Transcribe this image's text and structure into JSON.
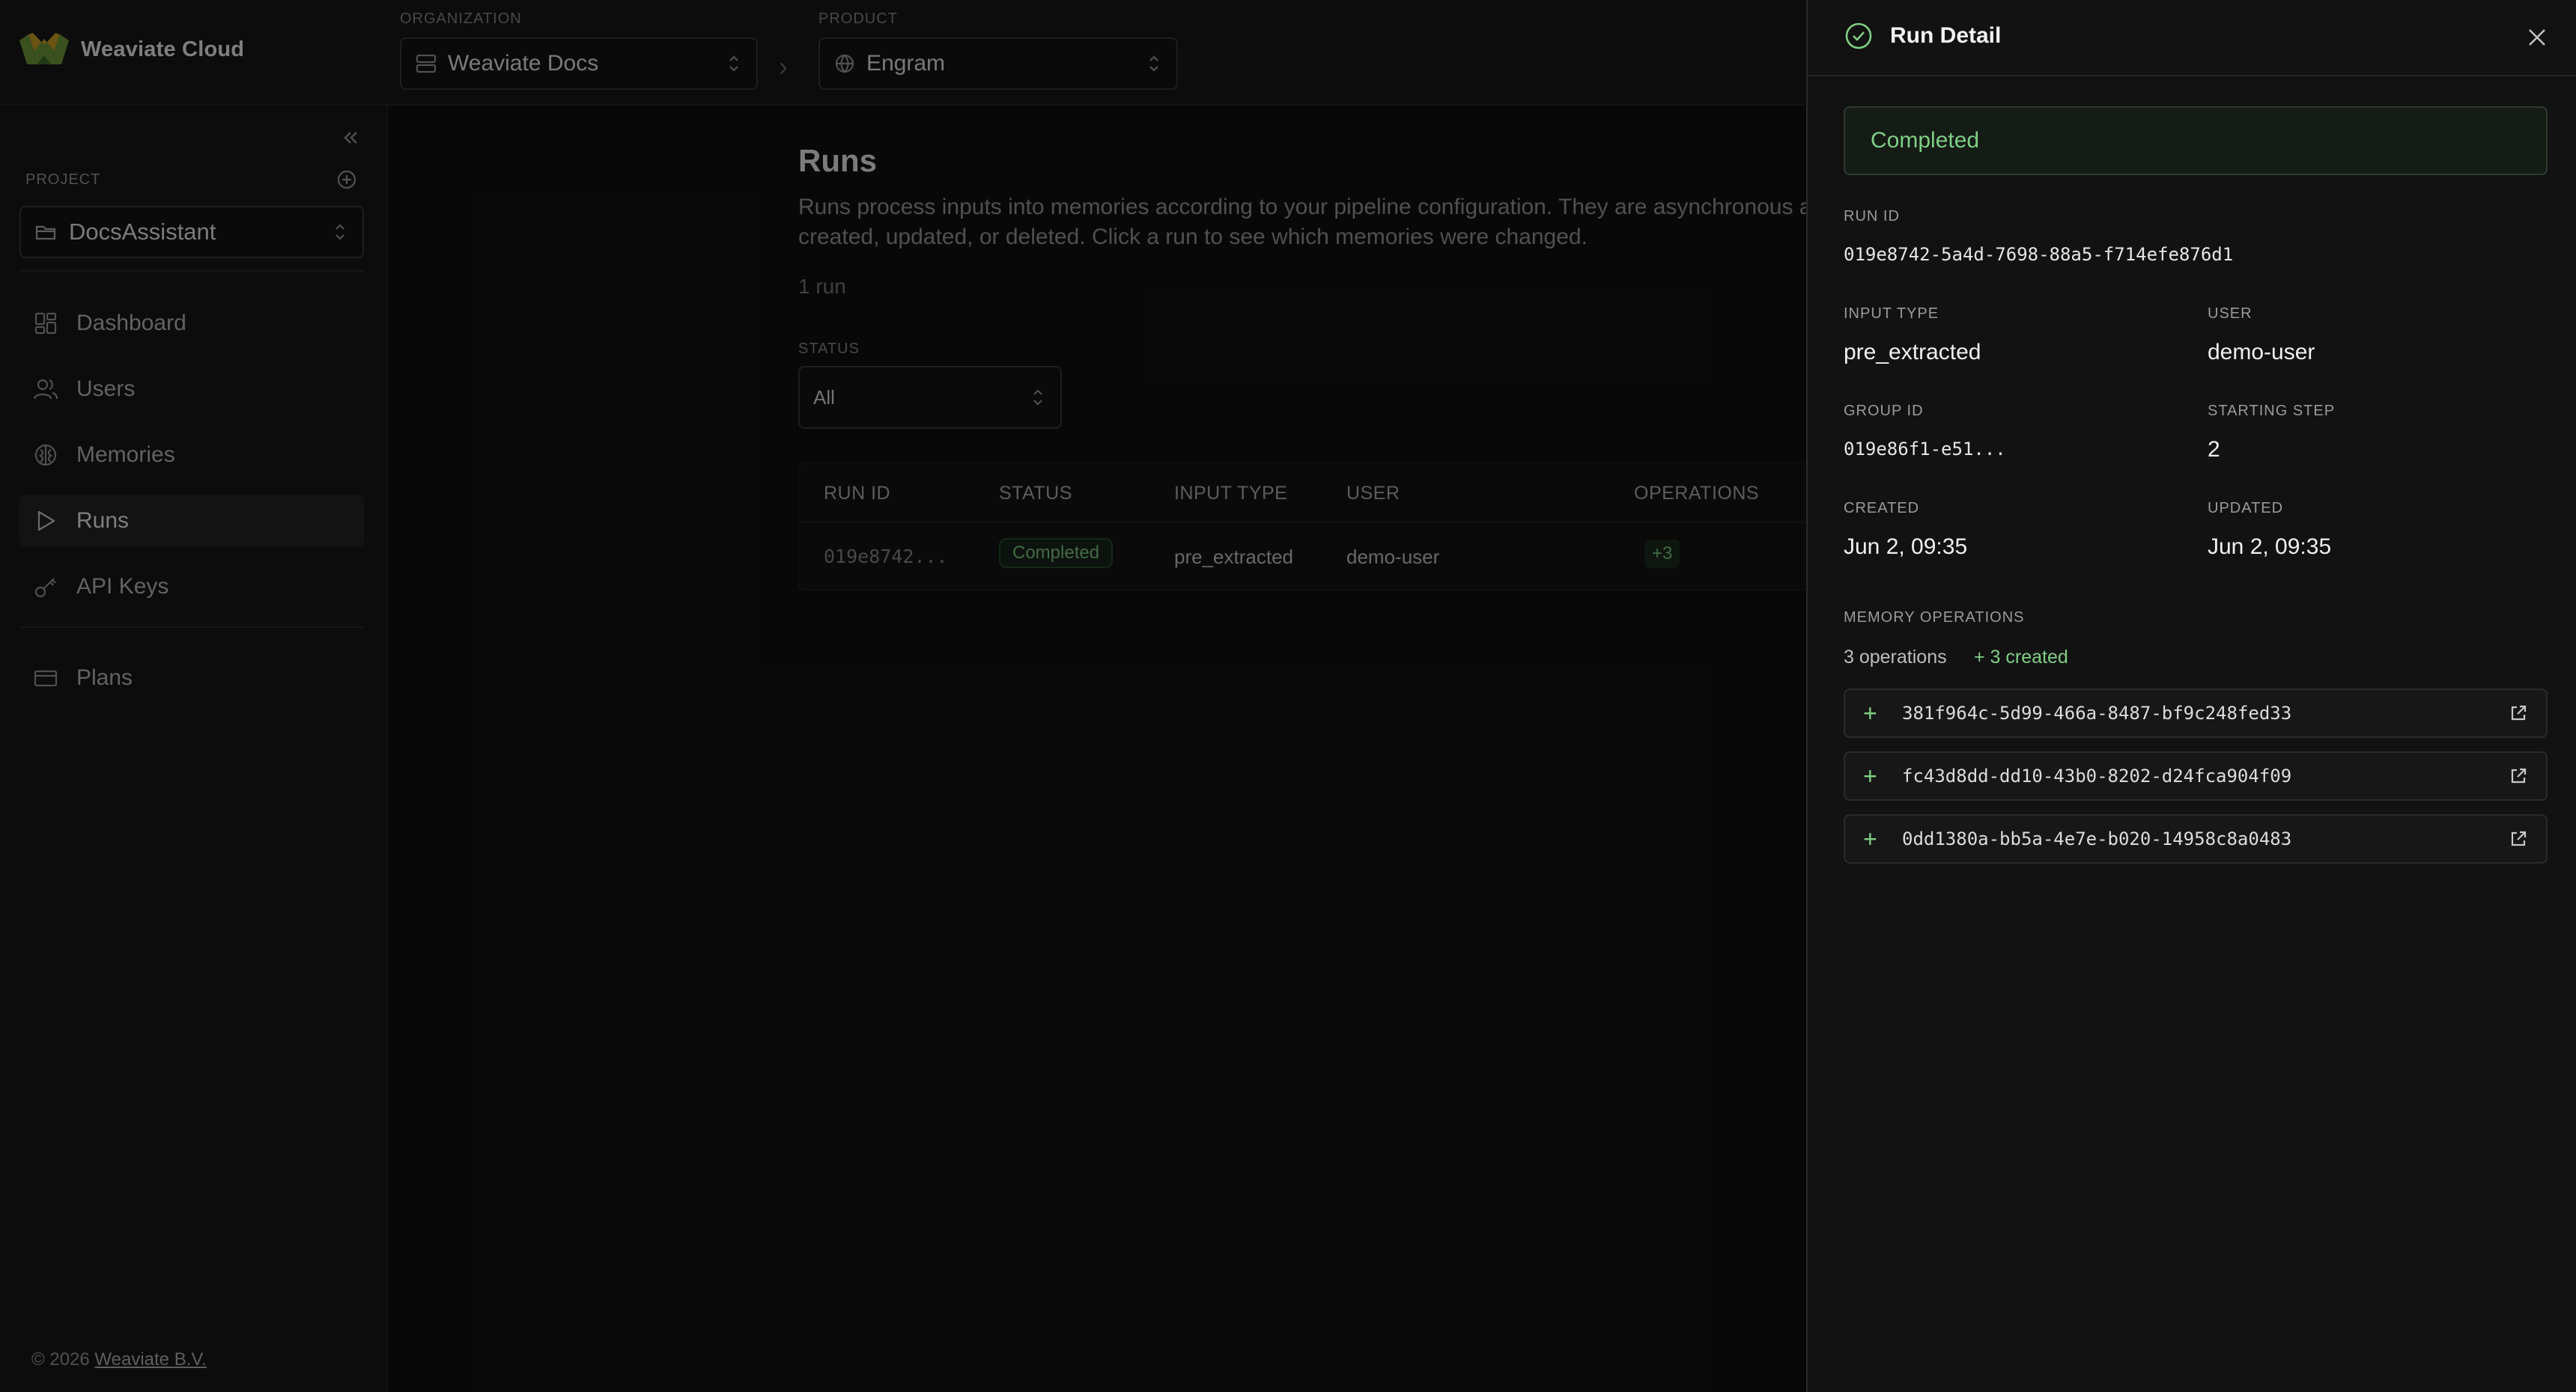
{
  "header": {
    "brand": "Weaviate Cloud",
    "organization": {
      "label": "ORGANIZATION",
      "value": "Weaviate Docs"
    },
    "product": {
      "label": "PRODUCT",
      "value": "Engram"
    }
  },
  "sidebar": {
    "project_label": "PROJECT",
    "project": "DocsAssistant",
    "items": [
      {
        "label": "Dashboard",
        "icon": "dashboard-icon"
      },
      {
        "label": "Users",
        "icon": "users-icon"
      },
      {
        "label": "Memories",
        "icon": "memories-icon"
      },
      {
        "label": "Runs",
        "icon": "runs-icon",
        "active": true
      },
      {
        "label": "API Keys",
        "icon": "key-icon"
      },
      {
        "label": "Plans",
        "icon": "card-icon"
      }
    ],
    "footer_prefix": "© 2026",
    "footer_link": "Weaviate B.V."
  },
  "main": {
    "title": "Runs",
    "description_line1": "Runs process inputs into memories according to your pipeline configuration. They are asynchronous a",
    "description_line2": "created, updated, or deleted. Click a run to see which memories were changed.",
    "count": "1 run",
    "status_filter": {
      "label": "STATUS",
      "value": "All"
    },
    "table": {
      "headers": [
        "RUN ID",
        "STATUS",
        "INPUT TYPE",
        "USER",
        "OPERATIONS"
      ],
      "rows": [
        {
          "run_id": "019e8742...",
          "status": "Completed",
          "input_type": "pre_extracted",
          "user": "demo-user",
          "operations": "+3"
        }
      ]
    }
  },
  "panel": {
    "title": "Run Detail",
    "status": "Completed",
    "fields": {
      "run_id_label": "RUN ID",
      "run_id": "019e8742-5a4d-7698-88a5-f714efe876d1",
      "input_type_label": "INPUT TYPE",
      "input_type": "pre_extracted",
      "user_label": "USER",
      "user": "demo-user",
      "group_id_label": "GROUP ID",
      "group_id": "019e86f1-e51...",
      "starting_step_label": "STARTING STEP",
      "starting_step": "2",
      "created_label": "CREATED",
      "created": "Jun 2, 09:35",
      "updated_label": "UPDATED",
      "updated": "Jun 2, 09:35"
    },
    "memory_ops": {
      "label": "MEMORY OPERATIONS",
      "summary": "3 operations",
      "created": "+ 3 created",
      "items": [
        "381f964c-5d99-466a-8487-bf9c248fed33",
        "fc43d8dd-dd10-43b0-8202-d24fca904f09",
        "0dd1380a-bb5a-4e7e-b020-14958c8a0483"
      ]
    }
  },
  "colors": {
    "accent_green": "#7fcf85",
    "background": "#111111",
    "panel": "#121212"
  }
}
